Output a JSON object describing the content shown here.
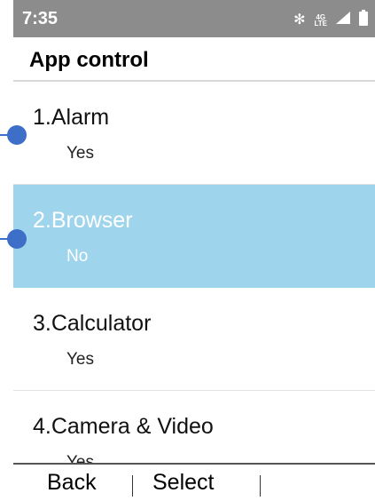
{
  "status_bar": {
    "time": "7:35",
    "icons": [
      "bluetooth-icon",
      "lte-icon",
      "signal-icon",
      "battery-icon"
    ],
    "lte_top": "4G",
    "lte_bottom": "LTE",
    "background": "#8c8c8c"
  },
  "header": {
    "title": "App control"
  },
  "list": {
    "items": [
      {
        "title": "1.Alarm",
        "value": "Yes"
      },
      {
        "title": "2.Browser",
        "value": "No"
      },
      {
        "title": "3.Calculator",
        "value": "Yes"
      },
      {
        "title": "4.Camera & Video",
        "value": "Yes"
      }
    ],
    "selected_index": 1,
    "highlight_color": "#9fd5ec"
  },
  "softkeys": {
    "left": "Back",
    "center": "Select",
    "right": ""
  },
  "annotation_color": "#3d6ec8"
}
